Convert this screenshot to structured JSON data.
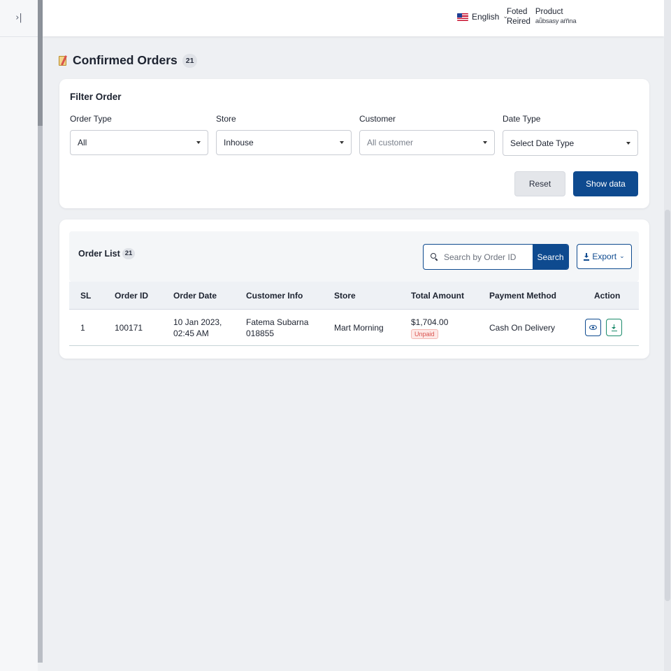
{
  "header": {
    "language": "English",
    "links": [
      {
        "top": "Foted",
        "bottom": "Reired"
      },
      {
        "top": "Product",
        "bottom": "aǖbsasy aŕñna"
      }
    ]
  },
  "page": {
    "title": "Confirmed Orders",
    "count": "21"
  },
  "filter": {
    "title": "Filter Order",
    "fields": [
      {
        "label": "Order Type",
        "value": "All"
      },
      {
        "label": "Store",
        "value": "Inhouse"
      },
      {
        "label": "Customer",
        "value": "All customer"
      },
      {
        "label": "Date Type",
        "value": "Select Date Type"
      }
    ],
    "reset_label": "Reset",
    "show_label": "Show data"
  },
  "order_list": {
    "title": "Order List",
    "count": "21",
    "search_placeholder": "Search by Order ID",
    "search_button": "Search",
    "export_label": "Export",
    "columns": [
      "SL",
      "Order ID",
      "Order Date",
      "Customer Info",
      "Store",
      "Total Amount",
      "Payment Method",
      "Action"
    ],
    "rows": [
      {
        "sl": "1",
        "order_id": "100171",
        "date_line1": "10 Jan 2023,",
        "date_line2": "02:45 AM",
        "customer_name": "Fatema Subarna",
        "customer_phone": "018855",
        "store": "Mart Morning",
        "total": "$1,704.00",
        "status": "Unpaid",
        "payment": "Cash On Delivery"
      }
    ]
  },
  "colors": {
    "primary": "#0e4a8f",
    "success": "#1a8a6a",
    "danger": "#d9534f"
  }
}
